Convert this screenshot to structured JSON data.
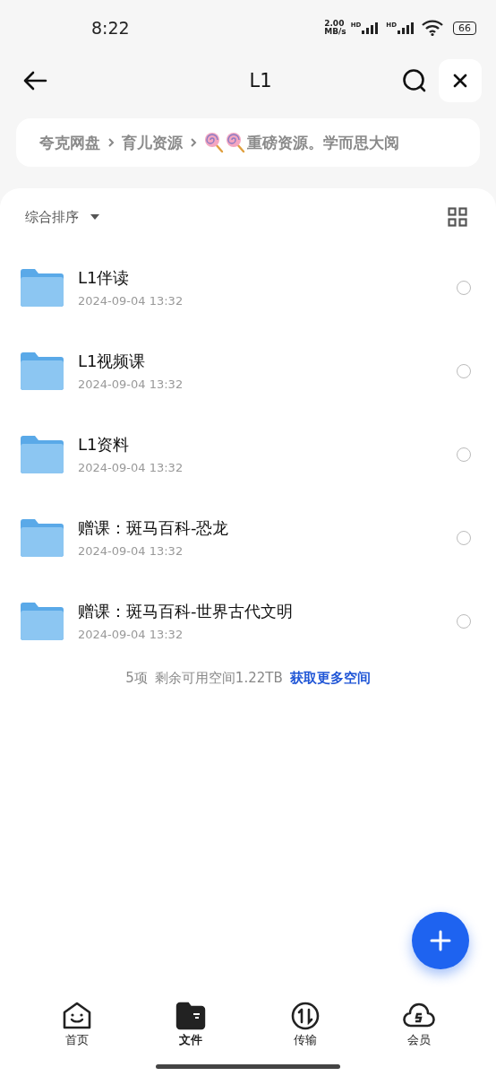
{
  "status_bar": {
    "time": "8:22",
    "speed_value": "2.00",
    "speed_unit": "MB/s",
    "sim_labels": [
      "HD",
      "HD"
    ],
    "battery": "66"
  },
  "header": {
    "title": "L1"
  },
  "breadcrumb": [
    {
      "label": "夸克网盘",
      "kind": "plain"
    },
    {
      "label": "育儿资源",
      "kind": "plain"
    },
    {
      "label": "重磅资源。学而思大阅",
      "kind": "lollipops"
    }
  ],
  "sort": {
    "label": "综合排序"
  },
  "files": [
    {
      "name": "L1伴读",
      "date": "2024-09-04 13:32",
      "selected": false
    },
    {
      "name": "L1视频课",
      "date": "2024-09-04 13:32",
      "selected": false
    },
    {
      "name": "L1资料",
      "date": "2024-09-04 13:32",
      "selected": false
    },
    {
      "name": "赠课：斑马百科-恐龙",
      "date": "2024-09-04 13:32",
      "selected": false
    },
    {
      "name": "赠课：斑马百科-世界古代文明",
      "date": "2024-09-04 13:32",
      "selected": false
    }
  ],
  "summary": {
    "count": "5项",
    "space": "剩余可用空间1.22TB",
    "link": "获取更多空间"
  },
  "tabs": [
    {
      "label": "首页",
      "selected": false
    },
    {
      "label": "文件",
      "selected": true
    },
    {
      "label": "传输",
      "selected": false
    },
    {
      "label": "会员",
      "selected": false
    }
  ]
}
